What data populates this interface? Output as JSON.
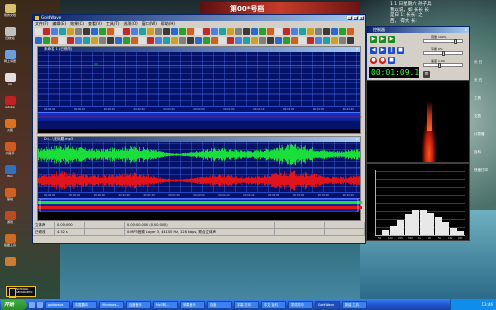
{
  "desktop": {
    "top_banner": "第00*号档",
    "bubble_lines": [
      "1 1  日星期六  孙子兵",
      "我以说，如  长长 长",
      "是日    1: 长长: 之",
      "  西，  得大 长:",
      "  "
    ],
    "left_icons": [
      {
        "label": "我的文档",
        "color": "#d8c070"
      },
      {
        "label": "回收站",
        "color": "#c0c0c0"
      },
      {
        "label": "网上邻居",
        "color": "#6aa0e0"
      },
      {
        "label": "AA",
        "color": "#e0e0e0"
      },
      {
        "label": "Adobe",
        "color": "#c02020"
      },
      {
        "label": "火狐",
        "color": "#e07020"
      },
      {
        "label": "六段平",
        "color": "#d05a20"
      },
      {
        "label": "Win",
        "color": "#3070c0"
      },
      {
        "label": "驱动",
        "color": "#d06020"
      },
      {
        "label": "游戏",
        "color": "#c04a20"
      },
      {
        "label": "截图工具",
        "color": "#d06a20"
      },
      {
        "label": "",
        "color": "#d07a30"
      }
    ],
    "right_icons": [
      "长 日",
      "长 白",
      "工具",
      "文档",
      "计算器",
      "百科",
      "快速打印"
    ]
  },
  "goldwave": {
    "title": "GoldWave",
    "menu": [
      "文件(F)",
      "编辑(E)",
      "效果(C)",
      "查看(V)",
      "工具(T)",
      "选项(O)",
      "窗口(W)",
      "帮助(H)"
    ],
    "doc1_title": "未命名 1 (已修改)",
    "doc2_title": "D:\\...\\无标题.mp3",
    "ruler1": [
      "00:00:00",
      "00:00:10",
      "00:00:20",
      "00:00:30",
      "00:00:40",
      "00:00:50",
      "00:01:00",
      "00:01:10",
      "00:01:20",
      "00:01:30",
      "00:01:40"
    ],
    "ruler2": [
      "00:00:00",
      "00:00:20",
      "00:00:40",
      "00:01:00",
      "00:01:20",
      "00:01:40",
      "00:02:00",
      "00:02:20",
      "00:02:40",
      "00:03:00",
      "00:03:20",
      "00:03:40",
      "00:04:00"
    ],
    "status": [
      [
        "立体声",
        "0.00:000",
        "",
        "0.00:00.000 (0.00.000)",
        "",
        ""
      ],
      [
        "已修改",
        "4.32 s",
        "",
        "0:MP3音频 Layer 3, 44100 Hz, 128 kbps, 联合立体声",
        "",
        ""
      ]
    ]
  },
  "controller": {
    "title": "控制器",
    "time": "00:01:09.1",
    "labels": [
      "音量 100%",
      "平衡 0%",
      "速度 1.00"
    ]
  },
  "taskbar": {
    "start": "开始",
    "tasks": [
      "goldwave",
      "中国要闻",
      "",
      "Windows...",
      "百度音乐",
      "Mp3转...",
      "",
      "苹果音乐",
      "百度",
      "字幕 打印",
      "",
      "中文 百科",
      "学词打印",
      "",
      "GoldWave",
      "",
      "新建 工具"
    ],
    "active_task": 14,
    "clock": "13:46"
  },
  "natgeo": [
    "NATIONAL",
    "GEOGRAPHIC"
  ],
  "colors": {
    "wave_bg": "#04126a",
    "wave_green": "#1adf3a",
    "wave_red": "#e0141a",
    "lcd_green": "#2aff2a"
  },
  "spectrum_data": {
    "labels": [
      "50",
      "100",
      "200",
      "500",
      "1k",
      "2k",
      "5k",
      "10k",
      "20k"
    ],
    "values": [
      0.08,
      0.14,
      0.22,
      0.32,
      0.38,
      0.38,
      0.33,
      0.28,
      0.2,
      0.1,
      0.06
    ]
  }
}
